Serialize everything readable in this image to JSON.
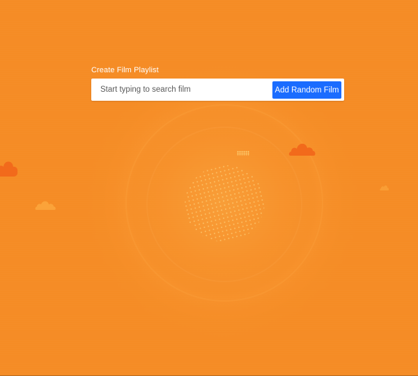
{
  "playlist": {
    "title": "Create Film Playlist",
    "search_placeholder": "Start typing to search film",
    "search_value": "",
    "random_button_label": "Add Random Film"
  },
  "colors": {
    "background": "#f58c25",
    "button": "#1a6cff",
    "cloud": "#f26a1b"
  },
  "icons": [
    "cloud-icon"
  ]
}
